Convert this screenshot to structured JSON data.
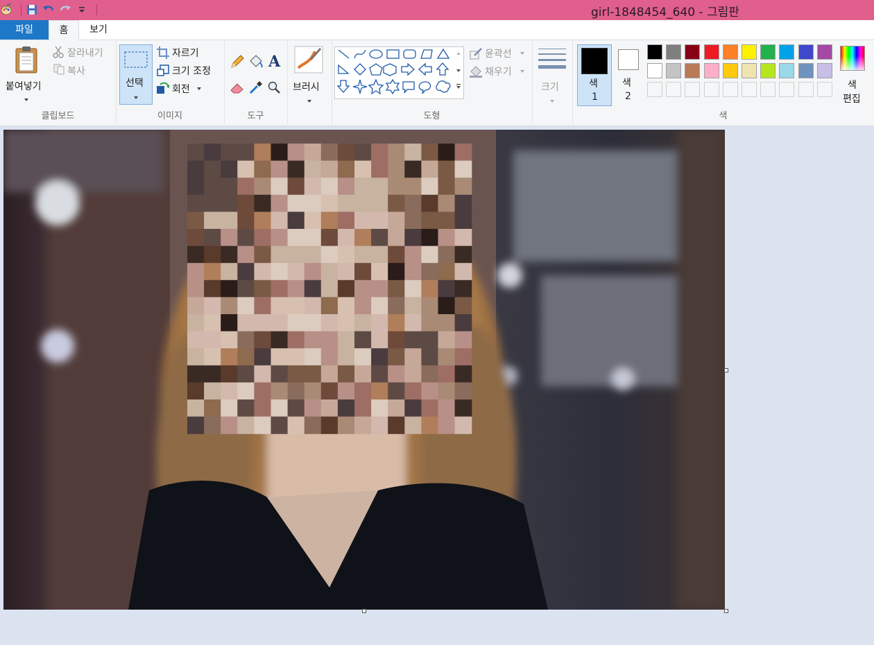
{
  "window": {
    "title": "girl-1848454_640 - 그림판"
  },
  "quick_access": [
    "paint-app-icon",
    "save-icon",
    "undo-icon",
    "redo-icon",
    "customize-dropdown-icon"
  ],
  "tabs": {
    "file": "파일",
    "home": "홈",
    "view": "보기"
  },
  "clipboard": {
    "paste": "붙여넣기",
    "cut": "잘라내기",
    "copy": "복사",
    "label": "클립보드"
  },
  "image_group": {
    "select": "선택",
    "crop": "자르기",
    "resize": "크기 조정",
    "rotate": "회전",
    "label": "이미지"
  },
  "tools": {
    "label": "도구"
  },
  "brushes": {
    "label": "브러시"
  },
  "shapes": {
    "outline": "윤곽선",
    "fill": "채우기",
    "label": "도형"
  },
  "size": {
    "label": "크기"
  },
  "colors": {
    "color1_label": "색",
    "color1_num": "1",
    "color2_label": "색",
    "color2_num": "2",
    "edit_label": "색",
    "edit_label2": "편집",
    "group_label": "색",
    "color1": "#000000",
    "color2": "#ffffff",
    "palette_row1": [
      "#000000",
      "#7f7f7f",
      "#880015",
      "#ed1c24",
      "#ff7f27",
      "#fff200",
      "#22b14c",
      "#00a2e8",
      "#3f48cc",
      "#a349a4"
    ],
    "palette_row2": [
      "#ffffff",
      "#c3c3c3",
      "#b97a57",
      "#ffaec9",
      "#ffc90e",
      "#efe4b0",
      "#b5e61d",
      "#99d9ea",
      "#7092be",
      "#c8bfe7"
    ]
  }
}
